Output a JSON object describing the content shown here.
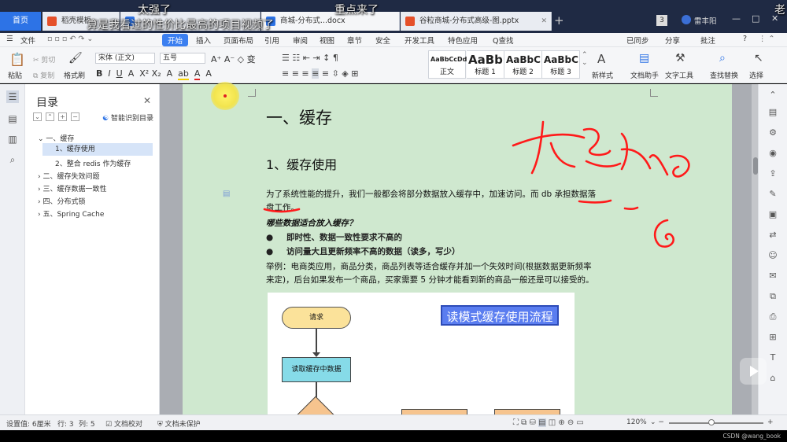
{
  "tabs": {
    "home": "首页",
    "t1": "稻壳模板",
    "t2": "商城-分布式...docx",
    "t3": "谷粒商城-分布式高级-图.pptx",
    "badge": "3",
    "user": "雷丰阳"
  },
  "overlay": {
    "o1": "太强了",
    "o2": "重点来了",
    "o3": "算是我看过的性价比最高的项目视频了",
    "o4": "老"
  },
  "menu": {
    "file": "文件",
    "start": "开始",
    "insert": "插入",
    "layout": "页面布局",
    "ref": "引用",
    "review": "审阅",
    "view": "视图",
    "chapter": "章节",
    "security": "安全",
    "dev": "开发工具",
    "special": "特色应用",
    "search": "Q查找",
    "sync": "已同步",
    "share": "分享",
    "comment": "批注",
    "help": "?"
  },
  "ribbon": {
    "paste": "粘贴",
    "cut": "剪切",
    "copy": "复制",
    "fmt": "格式刷",
    "font": "宋体 (正文)",
    "size": "五号",
    "styles": [
      {
        "sample": "AaBbCcDd",
        "label": "正文"
      },
      {
        "sample": "AaBb",
        "label": "标题 1"
      },
      {
        "sample": "AaBbC",
        "label": "标题 2"
      },
      {
        "sample": "AaBbC",
        "label": "标题 3"
      }
    ],
    "newstyle": "新样式",
    "assist": "文档助手",
    "texttool": "文字工具",
    "findreplace": "查找替换",
    "select": "选择"
  },
  "toc": {
    "title": "目录",
    "smart": "智能识别目录",
    "items": [
      "一、缓存",
      "1、缓存使用",
      "2、整合 redis 作为缓存",
      "二、缓存失效问题",
      "三、缓存数据一致性",
      "四、分布式锁",
      "五、Spring Cache"
    ]
  },
  "doc": {
    "h1": "一、缓存",
    "h2": "1、缓存使用",
    "p1": "为了系统性能的提升，我们一般都会将部分数据放入缓存中，加速访问。而 db 承担数据落",
    "p1b": "盘工作。",
    "q": "哪些数据适合放入缓存？",
    "b1": "即时性、数据一致性要求不高的",
    "b2": "访问量大且更新频率不高的数据（读多，写少）",
    "ex1": "举例：电商类应用，商品分类，商品列表等适合缓存并加一个失效时间(根据数据更新频率",
    "ex2": "来定)，后台如果发布一个商品，买家需要 5 分钟才能看到新的商品一般还是可以接受的。",
    "flow_title": "读模式缓存使用流程",
    "flow_req": "请求",
    "flow_read": "读取缓存中数据"
  },
  "status": {
    "setting": "设置值: 6厘米",
    "row": "行: 3",
    "col": "列: 5",
    "proof": "文档校对",
    "protect": "文档未保护",
    "zoom": "120%"
  },
  "watermark": "CSDN @wang_book",
  "colors": {
    "accent": "#2d73e6",
    "page": "#cfe8cf",
    "ink": "#ff1a1a",
    "flow_title_bg": "#5a7df0"
  }
}
